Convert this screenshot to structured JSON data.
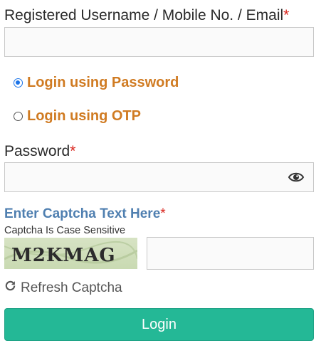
{
  "username": {
    "label": "Registered Username / Mobile No. / Email",
    "required_mark": "*",
    "value": ""
  },
  "login_mode": {
    "options": [
      {
        "label": "Login using Password",
        "selected": true
      },
      {
        "label": "Login using OTP",
        "selected": false
      }
    ]
  },
  "password": {
    "label": "Password",
    "required_mark": "*",
    "value": "",
    "toggle_icon": "eye-icon"
  },
  "captcha": {
    "title": "Enter Captcha Text Here",
    "required_mark": "*",
    "note": "Captcha Is Case Sensitive",
    "image_text": "M2KMAG",
    "value": "",
    "refresh_label": "Refresh Captcha",
    "refresh_icon": "refresh-icon"
  },
  "login_button": {
    "label": "Login",
    "color": "#24b896"
  },
  "colors": {
    "radio_label": "#d07b22",
    "captcha_title": "#4f7fb0",
    "required": "#d9241c"
  }
}
